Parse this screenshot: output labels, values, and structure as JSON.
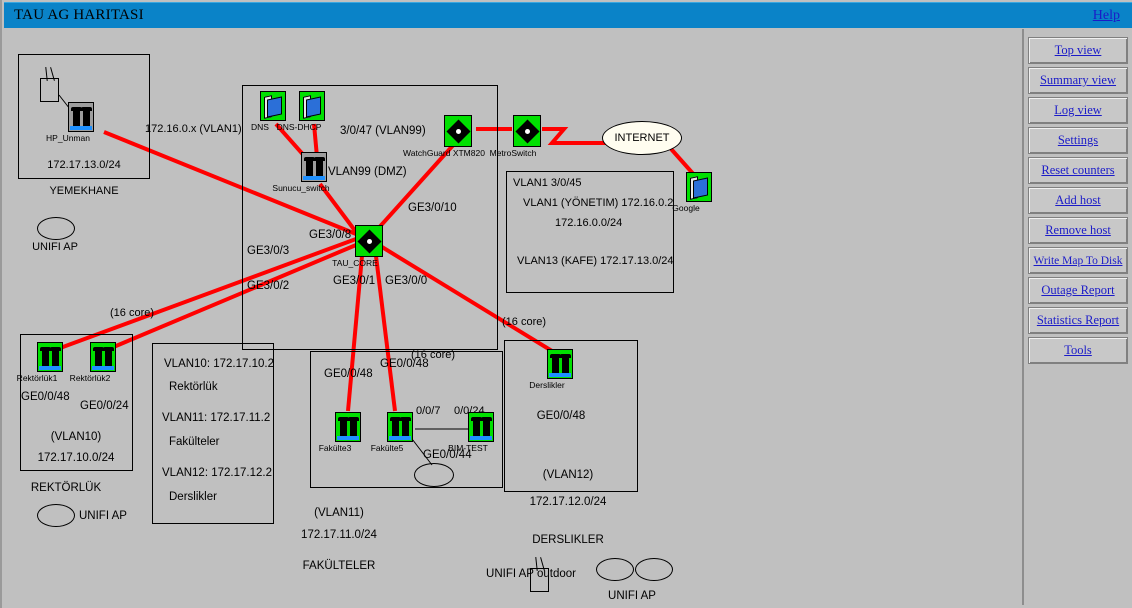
{
  "window": {
    "title": "TAU AG HARITASI",
    "help_label": "Help"
  },
  "sidebar": {
    "buttons": [
      {
        "label": "Top view",
        "name": "top-view"
      },
      {
        "label": "Summary view",
        "name": "summary-view"
      },
      {
        "label": "Log view",
        "name": "log-view"
      },
      {
        "label": "Settings",
        "name": "settings"
      },
      {
        "label": "Reset counters",
        "name": "reset-counters"
      },
      {
        "label": "Add host",
        "name": "add-host"
      },
      {
        "label": "Remove host",
        "name": "remove-host"
      },
      {
        "label": "Write Map To Disk",
        "name": "write-map-to-disk"
      },
      {
        "label": "Outage Report",
        "name": "outage-report"
      },
      {
        "label": "Statistics Report",
        "name": "statistics-report"
      },
      {
        "label": "Tools",
        "name": "tools"
      }
    ]
  },
  "map": {
    "nodes": [
      {
        "id": "hp_unman",
        "label": "HP_Unman",
        "type": "switch-gray"
      },
      {
        "id": "dns",
        "label": "DNS",
        "type": "server"
      },
      {
        "id": "dns_dhcp",
        "label": "DNS-DHCP",
        "type": "server"
      },
      {
        "id": "sunucu",
        "label": "Sunucu_switch",
        "type": "switch-gray"
      },
      {
        "id": "watchguard",
        "label": "WatchGuard XTM820",
        "type": "router"
      },
      {
        "id": "metroswitch",
        "label": "MetroSwitch",
        "type": "router"
      },
      {
        "id": "google",
        "label": "Google",
        "type": "server"
      },
      {
        "id": "tau_core",
        "label": "TAU_CORE",
        "type": "router"
      },
      {
        "id": "rektorluk1",
        "label": "Rektörlük1",
        "type": "switch"
      },
      {
        "id": "rektorluk2",
        "label": "Rektörlük2",
        "type": "switch"
      },
      {
        "id": "fakulte3",
        "label": "Fakülte3",
        "type": "switch"
      },
      {
        "id": "fakulte5",
        "label": "Fakülte5",
        "type": "switch"
      },
      {
        "id": "bim_test",
        "label": "BIM-TEST",
        "type": "switch"
      },
      {
        "id": "derslikler",
        "label": "Derslikler",
        "type": "switch"
      },
      {
        "id": "internet",
        "label": "INTERNET",
        "type": "cloud"
      }
    ],
    "labels": {
      "vlan1_link": "172.16.0.x (VLAN1)",
      "yemekhane_subnet": "172.17.13.0/24",
      "yemekhane_site": "YEMEKHANE",
      "unifi_ap_yemek": "UNIFI AP",
      "vlan99_port": "3/0/47 (VLAN99)",
      "vlan99_dmz": "VLAN99 (DMZ)",
      "ge3_0_10": "GE3/0/10",
      "ge3_0_8": "GE3/0/8",
      "ge3_0_3": "GE3/0/3",
      "ge3_0_2": "GE3/0/2",
      "ge3_0_1": "GE3/0/1",
      "ge3_0_0": "GE3/0/0",
      "core_16_left": "(16 core)",
      "core_16_mid": "(16 core)",
      "core_16_right": "(16 core)",
      "rek1_port": "GE0/0/48",
      "rek2_port": "GE0/0/24",
      "rek_vlan": "(VLAN10)",
      "rek_subnet": "172.17.10.0/24",
      "rek_site": "REKTÖRLÜK",
      "unifi_ap_rek": "UNIFI AP",
      "fak3_port": "GE0/0/48",
      "fak5_port": "GE0/0/48",
      "bim_port_a": "0/0/7",
      "bim_port_b": "0/0/24",
      "fak5_ap_port": "GE0/0/44",
      "fak_vlan": "(VLAN11)",
      "fak_subnet": "172.17.11.0/24",
      "fak_site": "FAKÜLTELER",
      "ders_port": "GE0/0/48",
      "ders_vlan": "(VLAN12)",
      "ders_subnet": "172.17.12.0/24",
      "ders_site": "DERSLIKLER",
      "unifi_ap_outdoor": "UNIFI AP outdoor",
      "unifi_ap_bottom": "UNIFI AP"
    },
    "vlan_info_box": {
      "line1": "VLAN1 3/0/45",
      "line2": "VLAN1 (YÖNETIM) 172.16.0.2",
      "line3": "172.16.0.0/24",
      "line4": "VLAN13 (KAFE) 172.17.13.0/24"
    },
    "vlan_legend_box": {
      "line1": "VLAN10: 172.17.10.2",
      "line2": "Rektörlük",
      "line3": "VLAN11: 172.17.11.2",
      "line4": "Fakülteler",
      "line5": "VLAN12: 172.17.12.2",
      "line6": "Derslikler"
    }
  },
  "colors": {
    "titlebar": "#0a83c8",
    "link": "#1b1bc8",
    "canvas": "#c0c0c0",
    "node_active": "#00e000",
    "node_inactive": "#9e9e9e",
    "connection": "#ff0000"
  }
}
